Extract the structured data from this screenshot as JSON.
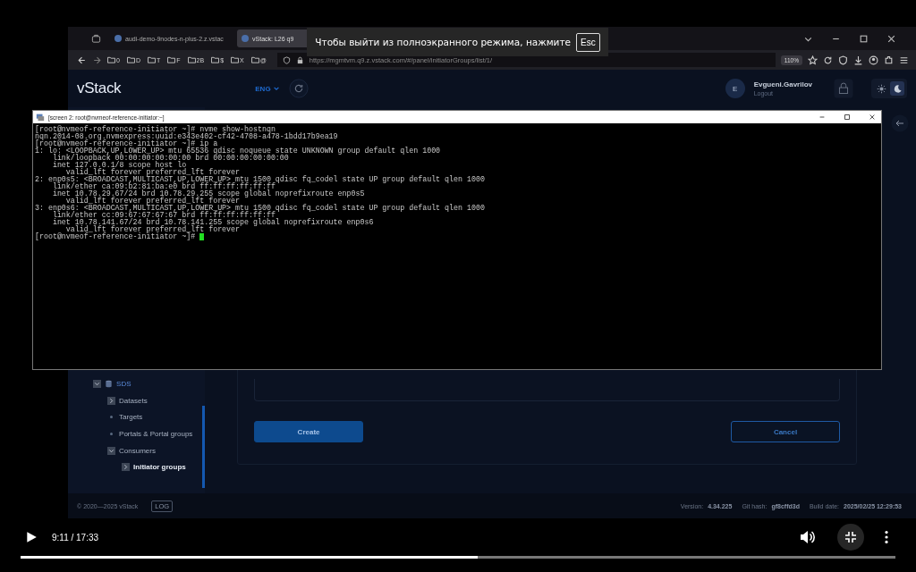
{
  "browser": {
    "tabs": [
      {
        "label": "audi-demo-9nodes-n-plus-2.z.vstac",
        "selected": false
      },
      {
        "label": "vStack: L26 q9",
        "selected": true
      }
    ],
    "bookmarks": [
      "0",
      "D",
      "T",
      "F",
      "2B",
      "$",
      "X",
      "@"
    ],
    "url": "https://mgmtvm.q9.z.vstack.com/#/panel/initiatorGroups/list/1/",
    "zoom": "110%"
  },
  "fullscreen_notice": {
    "text": "Чтобы выйти из полноэкранного режима, нажмите",
    "key": "Esc"
  },
  "app": {
    "logo": "vStack",
    "language": "ENG",
    "user": {
      "initial": "E",
      "name": "Evgueni.Gavrilov",
      "logout": "Logout"
    },
    "theme": [
      {
        "kind": "light",
        "selected": false
      },
      {
        "kind": "dark",
        "selected": true
      }
    ],
    "sidebar": [
      {
        "label": "SDS",
        "kind": "toggle",
        "expanded": true,
        "selected": false,
        "children": [
          {
            "label": "Datasets",
            "kind": "toggle",
            "expanded": false,
            "selected": false
          },
          {
            "label": "Targets",
            "kind": "leaf",
            "selected": false
          },
          {
            "label": "Portals & Portal groups",
            "kind": "leaf",
            "selected": false
          },
          {
            "label": "Consumers",
            "kind": "toggle",
            "expanded": true,
            "selected": false,
            "children": [
              {
                "label": "Initiator groups",
                "kind": "toggle",
                "expanded": false,
                "selected": true
              }
            ]
          }
        ]
      }
    ],
    "buttons": [
      {
        "label": "Create",
        "kind": "primary"
      },
      {
        "label": "Cancel",
        "kind": "secondary"
      }
    ],
    "footer": {
      "copyright": "© 2020—2025 vStack",
      "log": "LOG",
      "version_label": "Version:",
      "version": "4.34.225",
      "hash_label": "Git hash:",
      "hash": "gf8cffd3d",
      "build_label": "Build date:",
      "build": "2025/02/25 12:29:53"
    }
  },
  "terminal": {
    "title": "[screen 2: root@nvmeof-reference-initiator:~]",
    "lines": [
      "[root@nvmeof-reference-initiator ~]# nvme show-hostnqn",
      "nqn.2014-08.org.nvmexpress:uuid:e343e402-cf42-4708-a478-1bdd17b9ea19",
      "[root@nvmeof-reference-initiator ~]# ip a",
      "1: lo: <LOOPBACK,UP,LOWER_UP> mtu 65536 qdisc noqueue state UNKNOWN group default qlen 1000",
      "    link/loopback 00:00:00:00:00:00 brd 00:00:00:00:00:00",
      "    inet 127.0.0.1/8 scope host lo",
      "       valid_lft forever preferred_lft forever",
      "2: enp0s5: <BROADCAST,MULTICAST,UP,LOWER_UP> mtu 1500 qdisc fq_codel state UP group default qlen 1000",
      "    link/ether ca:09:b2:81:ba:e0 brd ff:ff:ff:ff:ff:ff",
      "    inet 10.78.29.67/24 brd 10.78.29.255 scope global noprefixroute enp0s5",
      "       valid_lft forever preferred_lft forever",
      "3: enp0s6: <BROADCAST,MULTICAST,UP,LOWER_UP> mtu 1500 qdisc fq_codel state UP group default qlen 1000",
      "    link/ether cc:09:67:67:67:67 brd ff:ff:ff:ff:ff:ff",
      "    inet 10.78.141.67/24 brd 10.78.141.255 scope global noprefixroute enp0s6",
      "       valid_lft forever preferred_lft forever",
      "[root@nvmeof-reference-initiator ~]# "
    ]
  },
  "player": {
    "time": "9:11 / 17:33",
    "level": 0.523
  }
}
